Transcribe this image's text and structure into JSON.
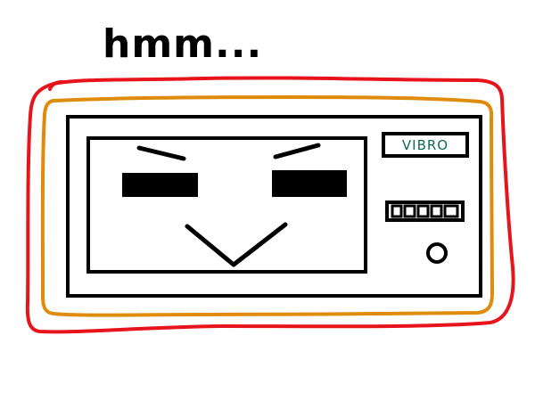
{
  "caption": "hmm...",
  "device": {
    "brand_label": "VIBRO",
    "keypad_keys": 5
  },
  "colors": {
    "outer_outline": "#e8141b",
    "inner_outline": "#df8b0c",
    "ink": "#000000",
    "brand_text": "#0f6b52",
    "background": "#ffffff"
  },
  "icons": {
    "power_button": "circle",
    "face": "smug-face"
  }
}
